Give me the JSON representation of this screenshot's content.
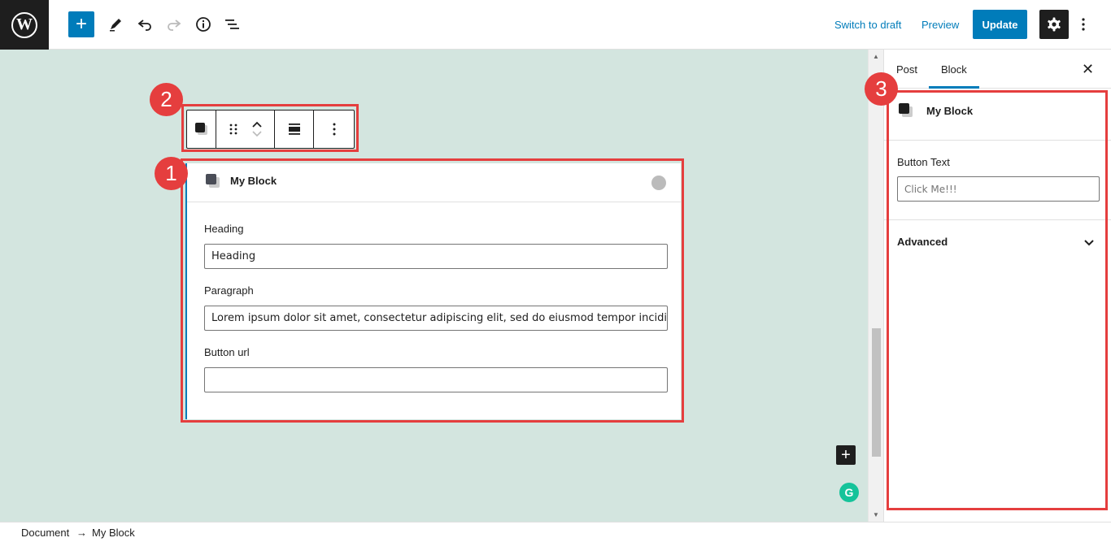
{
  "topbar": {
    "logo_letter": "W",
    "add_label": "+",
    "switch_draft": "Switch to draft",
    "preview": "Preview",
    "update": "Update",
    "icons": [
      "add-icon",
      "pencil-icon",
      "undo-icon",
      "redo-icon",
      "info-icon",
      "list-view-icon",
      "gear-icon",
      "more-vertical-icon"
    ]
  },
  "block": {
    "title": "My Block",
    "fields": [
      {
        "label": "Heading",
        "value": "Heading"
      },
      {
        "label": "Paragraph",
        "value": "Lorem ipsum dolor sit amet, consectetur adipiscing elit, sed do eiusmod tempor incididunt ut labore"
      },
      {
        "label": "Button url",
        "value": ""
      }
    ]
  },
  "sidebar": {
    "tabs": [
      {
        "label": "Post"
      },
      {
        "label": "Block"
      }
    ],
    "active_tab": "Block",
    "close": "✕",
    "block_title": "My Block",
    "button_text_label": "Button Text",
    "button_text_placeholder": "Click Me!!!",
    "advanced_label": "Advanced"
  },
  "footer": {
    "crumb_document": "Document",
    "separator": "→",
    "crumb_block": "My Block"
  },
  "annotations": [
    "1",
    "2",
    "3"
  ],
  "colors": {
    "accent": "#007cba",
    "annotation": "#e53e3e",
    "canvas": "#d3e5df",
    "dark": "#1e1e1e"
  }
}
